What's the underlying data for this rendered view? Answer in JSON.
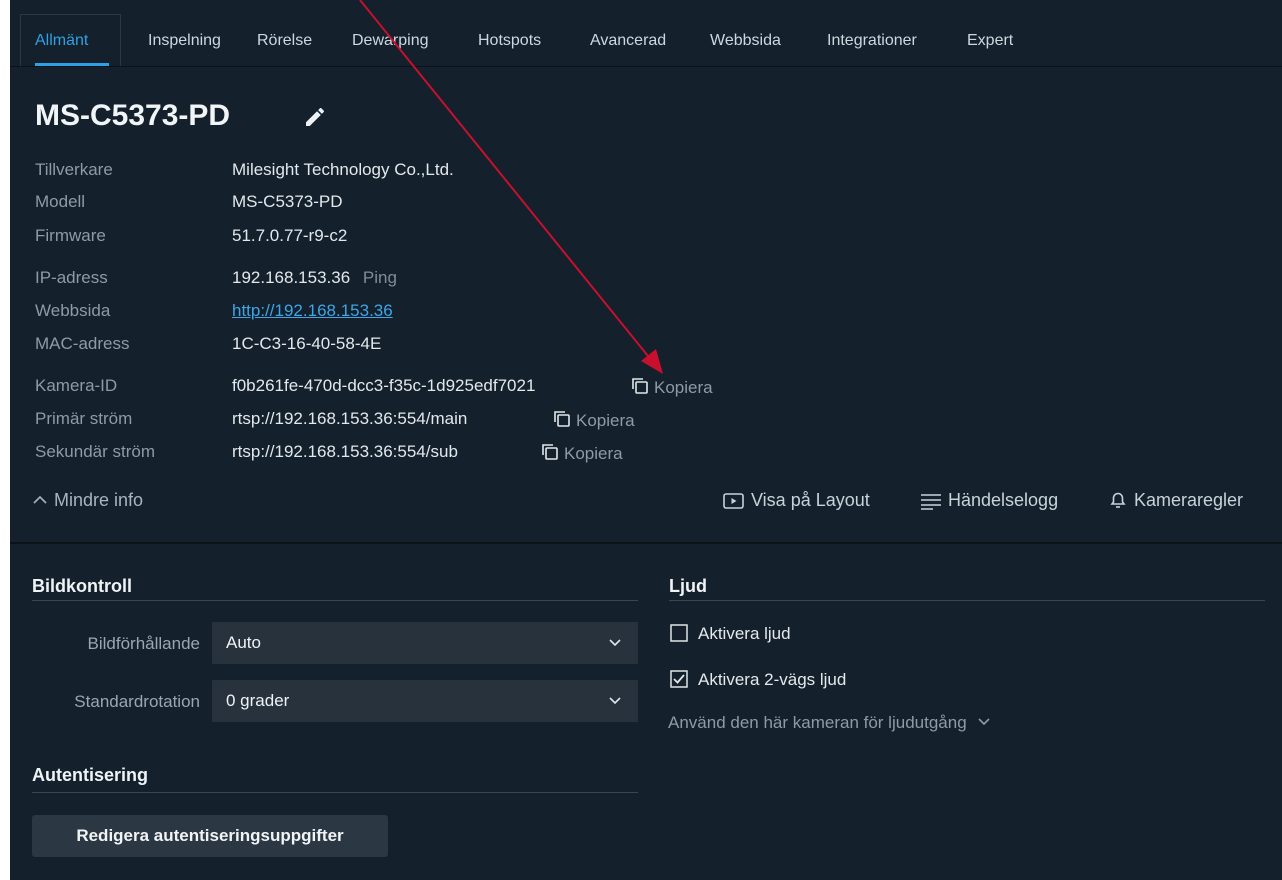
{
  "tabs": [
    {
      "label": "Allmänt",
      "active": true
    },
    {
      "label": "Inspelning",
      "active": false
    },
    {
      "label": "Rörelse",
      "active": false
    },
    {
      "label": "Dewarping",
      "active": false
    },
    {
      "label": "Hotspots",
      "active": false
    },
    {
      "label": "Avancerad",
      "active": false
    },
    {
      "label": "Webbsida",
      "active": false
    },
    {
      "label": "Integrationer",
      "active": false
    },
    {
      "label": "Expert",
      "active": false
    }
  ],
  "camera": {
    "name": "MS-C5373-PD",
    "manufacturer_label": "Tillverkare",
    "manufacturer": "Milesight Technology Co.,Ltd.",
    "model_label": "Modell",
    "model": "MS-C5373-PD",
    "firmware_label": "Firmware",
    "firmware": "51.7.0.77-r9-c2",
    "ip_label": "IP-adress",
    "ip": "192.168.153.36",
    "ping": "Ping",
    "web_label": "Webbsida",
    "web": "http://192.168.153.36",
    "mac_label": "MAC-adress",
    "mac": "1C-C3-16-40-58-4E",
    "id_label": "Kamera-ID",
    "id": "f0b261fe-470d-dcc3-f35c-1d925edf7021",
    "primary_label": "Primär ström",
    "primary": "rtsp://192.168.153.36:554/main",
    "secondary_label": "Sekundär ström",
    "secondary": "rtsp://192.168.153.36:554/sub",
    "copy": "Kopiera"
  },
  "actions": {
    "less_info": "Mindre info",
    "show_layout": "Visa på Layout",
    "event_log": "Händelselogg",
    "camera_rules": "Kameraregler"
  },
  "image_control": {
    "title": "Bildkontroll",
    "aspect_label": "Bildförhållande",
    "aspect_value": "Auto",
    "rotation_label": "Standardrotation",
    "rotation_value": "0 grader"
  },
  "auth": {
    "title": "Autentisering",
    "edit_button": "Redigera autentiseringsuppgifter"
  },
  "audio": {
    "title": "Ljud",
    "enable_audio": "Aktivera ljud",
    "enable_audio_checked": false,
    "enable_two_way": "Aktivera 2-vägs ljud",
    "enable_two_way_checked": true,
    "output_link": "Använd den här kameran för ljudutgång"
  },
  "colors": {
    "background": "#14202b",
    "accent": "#2ea0e6",
    "annotation_arrow": "#c8102e"
  },
  "icons": [
    "edit-icon",
    "copy-icon",
    "chevron-up-icon",
    "play-box-icon",
    "list-icon",
    "bell-icon",
    "chevron-down-icon",
    "checkbox-icon",
    "arrow-annotation"
  ]
}
